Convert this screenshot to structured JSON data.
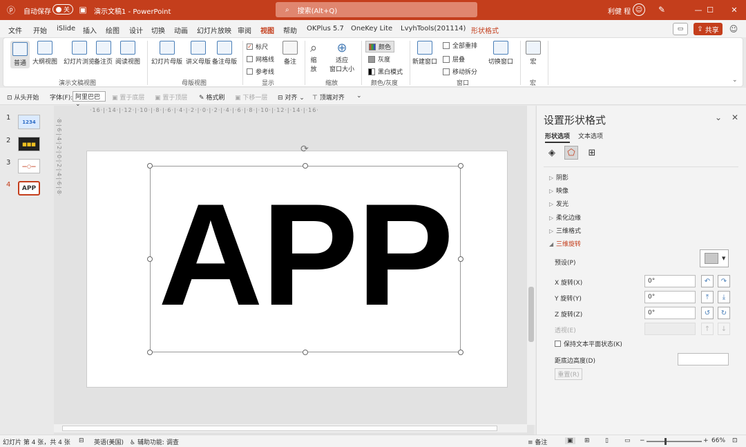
{
  "titlebar": {
    "autosave_label": "自动保存",
    "autosave_state": "关",
    "document_title": "演示文稿1  -  PowerPoint",
    "search_placeholder": "搜索(Alt+Q)",
    "user_name": "利健 程",
    "accent": "#c43e1c"
  },
  "tabs": [
    "文件",
    "开始",
    "iSlide",
    "插入",
    "绘图",
    "设计",
    "切换",
    "动画",
    "幻灯片放映",
    "审阅",
    "视图",
    "帮助",
    "OKPlus 5.7",
    "OneKey Lite",
    "LvyhTools(201114)",
    "形状格式"
  ],
  "active_tab": "视图",
  "share_label": "共享",
  "ribbon": {
    "view_buttons": [
      "普通",
      "大纲视图",
      "幻灯片浏览",
      "备注页",
      "阅读视图"
    ],
    "group_doc_view": "演示文稿视图",
    "master_buttons": [
      "幻灯片母版",
      "讲义母版",
      "备注母版"
    ],
    "group_master": "母版视图",
    "show_checks": [
      {
        "label": "标尺",
        "checked": true
      },
      {
        "label": "网格线",
        "checked": false
      },
      {
        "label": "参考线",
        "checked": false
      }
    ],
    "notes_label": "备注",
    "group_show": "显示",
    "zoom_label": "缩\n放",
    "fit_label": "适应\n窗口大小",
    "group_zoom": "缩放",
    "color_items": [
      "颜色",
      "灰度",
      "黑白模式"
    ],
    "group_color": "颜色/灰度",
    "new_window": "新建窗口",
    "window_items": [
      "全部重排",
      "层叠",
      "移动拆分"
    ],
    "switch_window": "切换窗口",
    "group_window": "窗口",
    "macro_label": "宏",
    "group_macro": "宏"
  },
  "qat": {
    "from_start": "从头开始",
    "font_label": "字体(F):",
    "font_value": "阿里巴巴",
    "bring_front": "置于底层",
    "send_back": "置于顶层",
    "format_painter": "格式刷",
    "move_down": "下移一层",
    "align": "对齐",
    "top_align": "顶端对齐"
  },
  "ruler_h": "·16·|·14·|·12·|·10·|·8·|·6·|·4·|·2·|·0·|·2·|·4·|·6·|·8·|·10·|·12·|·14·|·16·",
  "ruler_v": "·8·|·6·|·4·|·2·|·0·|·2·|·4·|·6·|·8·",
  "slides": [
    {
      "num": "1",
      "text": "1234"
    },
    {
      "num": "2",
      "text": "■■■"
    },
    {
      "num": "3",
      "text": "—○—"
    },
    {
      "num": "4",
      "text": "APP"
    }
  ],
  "slide_text": "APP",
  "panel": {
    "title": "设置形状格式",
    "tab_shape": "形状选项",
    "tab_text": "文本选项",
    "sections": [
      "阴影",
      "映像",
      "发光",
      "柔化边缘",
      "三维格式",
      "三维旋转"
    ],
    "preset_label": "预设(P)",
    "x_label": "X 旋转(X)",
    "x_value": "0°",
    "y_label": "Y 旋转(Y)",
    "y_value": "0°",
    "z_label": "Z 旋转(Z)",
    "z_value": "0°",
    "persp_label": "透视(E)",
    "keep_flat": "保持文本平面状态(K)",
    "distance_label": "距底边高度(D)",
    "reset_label": "重置(R)"
  },
  "status": {
    "slide_info": "幻灯片 第 4 张，共 4 张",
    "language": "英语(美国)",
    "accessibility": "辅助功能: 调查",
    "notes": "备注",
    "zoom": "66%"
  }
}
